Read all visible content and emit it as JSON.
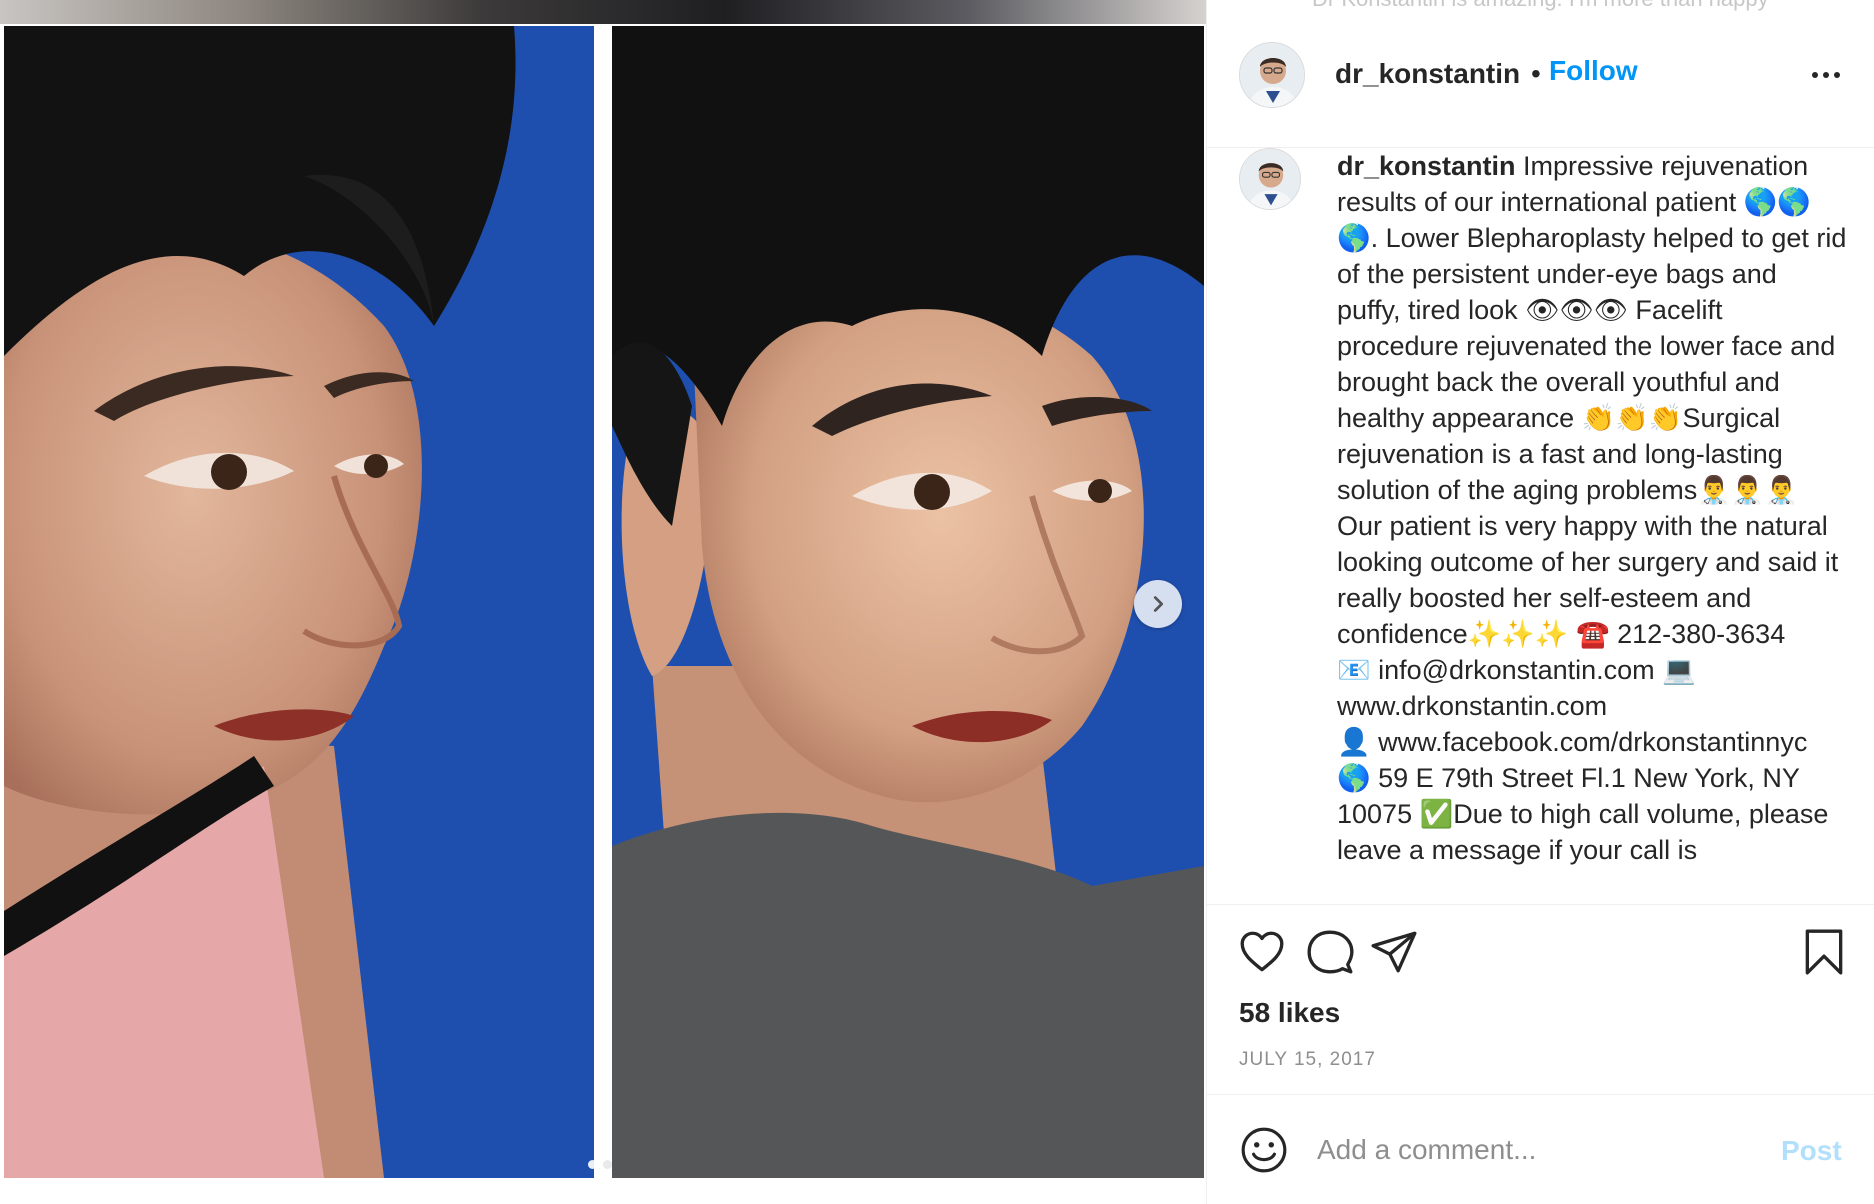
{
  "background_caption_cropped": "Dr Konstantin is amazing. I'm more than happy",
  "post": {
    "username": "dr_konstantin",
    "follow_label": "Follow",
    "separator": "•",
    "more_icon": "more-options-icon",
    "caption": {
      "username": "dr_konstantin",
      "text": " Impressive rejuvenation results of our international patient 🌎🌎🌎. Lower Blepharoplasty helped to get rid of the persistent under-eye bags and puffy, tired look 👁👁👁 Facelift procedure rejuvenated the lower face and brought back the overall youthful and healthy appearance 👏👏👏Surgical rejuvenation is a fast and long-lasting solution of the aging problems👨‍⚕️👨‍⚕️👨‍⚕️ Our patient is very happy with the natural looking outcome of her surgery and said it really boosted her self-esteem and confidence✨✨✨ ☎️ 212-380-3634\n📧 info@drkonstantin.com 💻 www.drkonstantin.com\n👤 www.facebook.com/drkonstantinnyc\n🌎 59 E 79th Street Fl.1 New York, NY 10075 ✅Due to high call volume, please leave a message if your call is"
    },
    "likes": "58 likes",
    "date": "JULY 15, 2017",
    "actions": {
      "like_icon": "heart-icon",
      "comment_icon": "comment-icon",
      "share_icon": "share-icon",
      "save_icon": "bookmark-icon"
    },
    "comment": {
      "placeholder": "Add a comment...",
      "post_label": "Post",
      "emoji_icon": "emoji-icon"
    }
  },
  "media": {
    "next_icon": "chevron-right-icon",
    "slide_count": 2,
    "active_slide": 1
  },
  "colors": {
    "link_blue": "#0095f6",
    "post_disabled": "#b2dffc",
    "photo_background": "#1f4fae",
    "text": "#262626",
    "muted": "#8e8e8e"
  }
}
